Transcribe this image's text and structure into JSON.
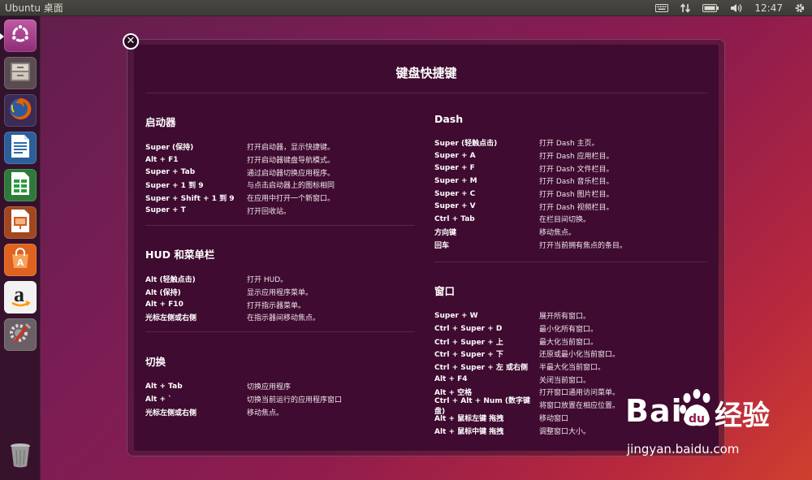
{
  "top_panel": {
    "title": "Ubuntu 桌面",
    "indicators": [
      {
        "icon": "keyboard-icon"
      },
      {
        "icon": "network-arrows-icon"
      },
      {
        "icon": "battery-icon"
      },
      {
        "icon": "volume-icon"
      }
    ],
    "clock": "12:47",
    "settings_icon": "gear-icon"
  },
  "launcher": {
    "items": [
      {
        "name": "dash-home",
        "icon": "ubuntu-logo-icon"
      },
      {
        "name": "files",
        "icon": "file-cabinet-icon"
      },
      {
        "name": "firefox",
        "icon": "firefox-icon"
      },
      {
        "name": "writer",
        "icon": "libreoffice-writer-icon"
      },
      {
        "name": "calc",
        "icon": "libreoffice-calc-icon"
      },
      {
        "name": "impress",
        "icon": "libreoffice-impress-icon"
      },
      {
        "name": "software-center",
        "icon": "shopping-bag-icon"
      },
      {
        "name": "amazon",
        "icon": "amazon-icon"
      },
      {
        "name": "system-settings",
        "icon": "settings-tools-icon"
      },
      {
        "name": "trash",
        "icon": "trash-icon"
      }
    ],
    "amazon_letter": "a"
  },
  "overlay": {
    "close_glyph": "✕",
    "title": "键盘快捷键",
    "left_sections": [
      {
        "heading": "启动器",
        "rows": [
          {
            "key": "Super (保持)",
            "desc": "打开启动器，显示快捷键。"
          },
          {
            "key": "Alt + F1",
            "desc": "打开启动器键盘导航模式。"
          },
          {
            "key": "Super + Tab",
            "desc": "通过启动器切换应用程序。"
          },
          {
            "key": "Super + 1 到 9",
            "desc": "与点击启动器上的图标相同"
          },
          {
            "key": "Super + Shift + 1 到 9",
            "desc": "在应用中打开一个新窗口。"
          },
          {
            "key": "Super + T",
            "desc": "打开回收站。"
          }
        ]
      },
      {
        "heading": "HUD 和菜单栏",
        "rows": [
          {
            "key": "Alt (轻触点击)",
            "desc": "打开 HUD。"
          },
          {
            "key": "Alt (保持)",
            "desc": "显示应用程序菜单。"
          },
          {
            "key": "Alt + F10",
            "desc": "打开指示器菜单。"
          },
          {
            "key": "光标左侧或右侧",
            "desc": "在指示器间移动焦点。"
          }
        ]
      },
      {
        "heading": "切换",
        "rows": [
          {
            "key": "Alt + Tab",
            "desc": "切换应用程序"
          },
          {
            "key": "Alt + `",
            "desc": "切换当前运行的应用程序窗口"
          },
          {
            "key": "光标左侧或右侧",
            "desc": "移动焦点。"
          }
        ]
      }
    ],
    "right_sections": [
      {
        "heading": "Dash",
        "rows": [
          {
            "key": "Super (轻触点击)",
            "desc": "打开 Dash 主页。"
          },
          {
            "key": "Super + A",
            "desc": "打开 Dash 应用栏目。"
          },
          {
            "key": "Super + F",
            "desc": "打开 Dash 文件栏目。"
          },
          {
            "key": "Super + M",
            "desc": "打开 Dash 音乐栏目。"
          },
          {
            "key": "Super + C",
            "desc": "打开 Dash 图片栏目。"
          },
          {
            "key": "Super + V",
            "desc": "打开 Dash 视频栏目。"
          },
          {
            "key": "Ctrl + Tab",
            "desc": "在栏目间切换。"
          },
          {
            "key": "方向键",
            "desc": "移动焦点。"
          },
          {
            "key": "回车",
            "desc": "打开当前拥有焦点的条目。"
          }
        ]
      },
      {
        "heading": "窗口",
        "rows": [
          {
            "key": "Super + W",
            "desc": "展开所有窗口。"
          },
          {
            "key": "Ctrl + Super + D",
            "desc": "最小化所有窗口。"
          },
          {
            "key": "Ctrl + Super + 上",
            "desc": "最大化当前窗口。"
          },
          {
            "key": "Ctrl + Super + 下",
            "desc": "还原或最小化当前窗口。"
          },
          {
            "key": "Ctrl + Super + 左 或右侧",
            "desc": "半最大化当前窗口。"
          },
          {
            "key": "Alt + F4",
            "desc": "关闭当前窗口。"
          },
          {
            "key": "Alt + 空格",
            "desc": "打开窗口通用访问菜单。"
          },
          {
            "key": "Ctrl + Alt + Num (数字键盘)",
            "desc": "将窗口放置在相应位置。"
          },
          {
            "key": "Alt + 鼠标左键 拖拽",
            "desc": "移动窗口"
          },
          {
            "key": "Alt + 鼠标中键 拖拽",
            "desc": "调整窗口大小。"
          }
        ]
      }
    ]
  },
  "watermark": {
    "brand_part1": "Bai",
    "brand_part2": "经验",
    "url": "jingyan.baidu.com"
  }
}
